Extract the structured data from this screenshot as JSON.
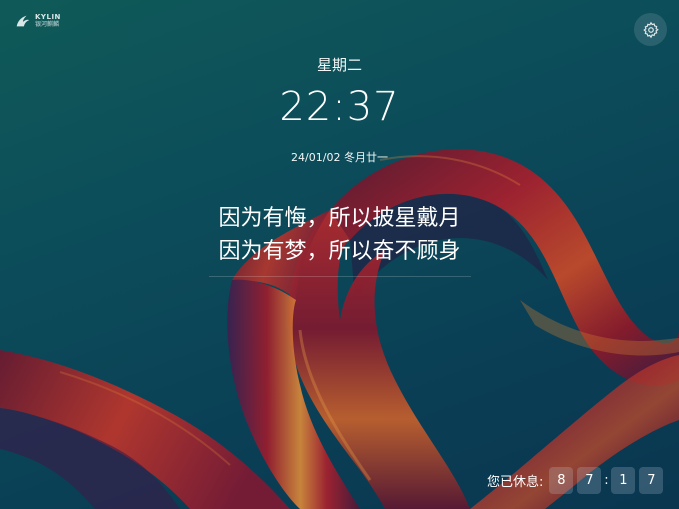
{
  "logo": {
    "name": "KYLIN",
    "subtitle": "银河麒麟"
  },
  "settings": {
    "icon": "gear-icon"
  },
  "clock": {
    "weekday": "星期二",
    "time": "22:37",
    "date": "24/01/02 冬月廿一"
  },
  "quote": {
    "line1": "因为有悔，所以披星戴月",
    "line2": "因为有梦，所以奋不顾身"
  },
  "rest": {
    "label": "您已休息:",
    "digits": [
      "8",
      "7",
      "1",
      "7"
    ],
    "separator": ":"
  },
  "colors": {
    "background": "#0c4d5a",
    "ribbon_red": "#9a1a2a",
    "ribbon_orange": "#d07a2a",
    "ribbon_purple": "#3a2a5a"
  }
}
